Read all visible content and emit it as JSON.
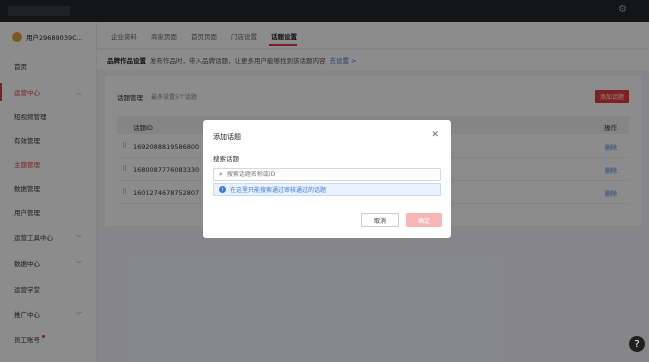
{
  "topbar": {
    "settings_icon": "gear-icon"
  },
  "sidebar": {
    "user_name": "用户29689039C...",
    "items": [
      {
        "label": "首页"
      },
      {
        "label": "运营中心"
      },
      {
        "label": "短视频管理"
      },
      {
        "label": "有效管理"
      },
      {
        "label": "主题管理"
      },
      {
        "label": "数据管理"
      },
      {
        "label": "用户管理"
      },
      {
        "label": "运营工具中心"
      },
      {
        "label": "数据中心"
      },
      {
        "label": "运营学堂"
      },
      {
        "label": "推广中心"
      },
      {
        "label": "员工账号"
      }
    ]
  },
  "tabs": [
    "企业资料",
    "商家页面",
    "首页页面",
    "门店设置",
    "话题设置"
  ],
  "notice": {
    "title": "品牌作品设置",
    "text": "发布作品时，带入品牌话题，让更多用户能够找到该话题内容",
    "link": "去设置 >"
  },
  "card": {
    "title": "话题管理",
    "subtitle": "最多设置5个话题",
    "add_button": "添加话题"
  },
  "table": {
    "headers": [
      "话题ID",
      "操作"
    ],
    "rows": [
      {
        "id": "1692088819586800",
        "action": "删除"
      },
      {
        "id": "1680087776083330",
        "action": "删除"
      },
      {
        "id": "1601274678752807",
        "action": "删除"
      }
    ]
  },
  "modal": {
    "title": "添加话题",
    "field_label": "搜索话题",
    "search_placeholder": "搜索话题名称或ID",
    "hint": "在这里只能搜索通过审核通过的话题",
    "cancel": "取消",
    "confirm": "确定"
  },
  "help": "?",
  "colors": {
    "accent": "#e23d3d",
    "link": "#3a7bd5",
    "topbar": "#25272b"
  }
}
